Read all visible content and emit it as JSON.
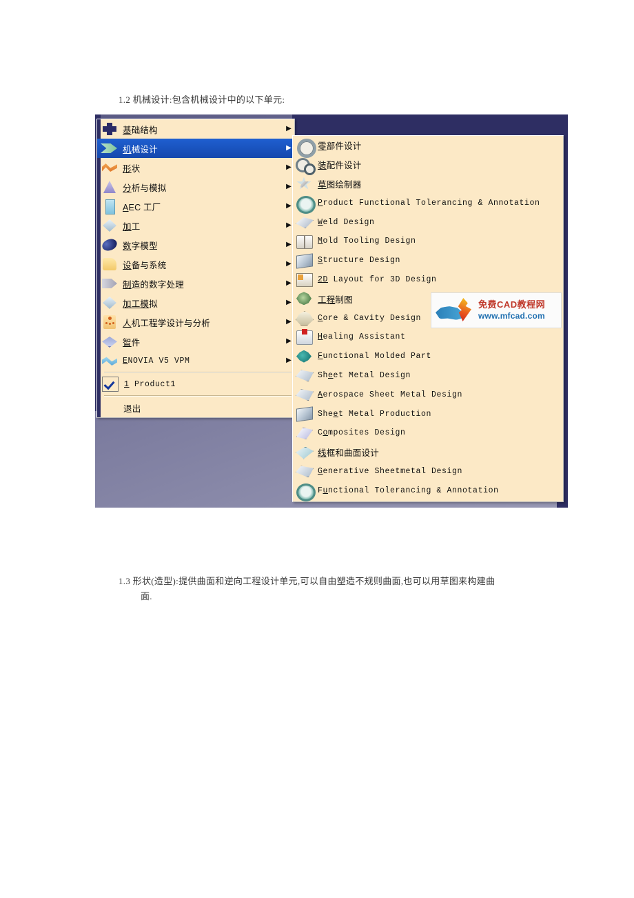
{
  "document": {
    "para_1_2": "1.2  机械设计:包含机械设计中的以下单元:",
    "para_1_3_line1": "1.3  形状(造型):提供曲面和逆向工程设计单元,可以自由塑造不规则曲面,也可以用草图来构建曲",
    "para_1_3_line2": "面."
  },
  "start_menu": {
    "items": [
      {
        "label": "基础结构",
        "icon": "cross-icon",
        "arrow": "▶",
        "selected": false
      },
      {
        "label": "机械设计",
        "icon": "green-arrow-icon",
        "arrow": "▶",
        "selected": true
      },
      {
        "label": "形状",
        "icon": "orange-wave-icon",
        "arrow": "▶",
        "selected": false
      },
      {
        "label": "分析与模拟",
        "icon": "purple-triangle-icon",
        "arrow": "▶",
        "selected": false
      },
      {
        "label": "AEC 工厂",
        "icon": "blue-tower-icon",
        "arrow": "▶",
        "selected": false
      },
      {
        "label": "加工",
        "icon": "diamond-icon",
        "arrow": "▶",
        "selected": false
      },
      {
        "label": "数字模型",
        "icon": "blue-ellipse-icon",
        "arrow": "▶",
        "selected": false
      },
      {
        "label": "设备与系统",
        "icon": "yellow-square-icon",
        "arrow": "▶",
        "selected": false
      },
      {
        "label": "制造的数字处理",
        "icon": "gray-arrow-icon",
        "arrow": "▶",
        "selected": false
      },
      {
        "label": "加工模拟",
        "icon": "diamond-icon",
        "arrow": "▶",
        "selected": false
      },
      {
        "label": "人机工程学设计与分析",
        "icon": "person-icon",
        "arrow": "▶",
        "selected": false
      },
      {
        "label": "智件",
        "icon": "plates-icon",
        "arrow": "▶",
        "selected": false
      },
      {
        "label": "ENOVIA V5 VPM",
        "icon": "ribbon-icon",
        "arrow": "▶",
        "selected": false
      }
    ],
    "recent_document": {
      "label": "1 Product1",
      "checked": true
    },
    "exit": "退出"
  },
  "sub_menu": {
    "items": [
      {
        "label": "零部件设计",
        "icon": "gear-icon",
        "script": "cjk"
      },
      {
        "label": "装配件设计",
        "icon": "double-gear-icon",
        "script": "cjk"
      },
      {
        "label": "草图绘制器",
        "icon": "sketch-star-icon",
        "script": "cjk"
      },
      {
        "label": "Product Functional Tolerancing & Annotation",
        "icon": "tolerancing-icon",
        "script": "latin"
      },
      {
        "label": "Weld Design",
        "icon": "weld-icon",
        "script": "latin"
      },
      {
        "label": "Mold Tooling Design",
        "icon": "mold-icon",
        "script": "latin"
      },
      {
        "label": "Structure Design",
        "icon": "structure-icon",
        "script": "latin"
      },
      {
        "label": "2D Layout for 3D Design",
        "icon": "layout-2d-icon",
        "script": "latin"
      },
      {
        "label": "工程制图",
        "icon": "drafting-icon",
        "script": "cjk"
      },
      {
        "label": "Core & Cavity Design",
        "icon": "core-cavity-icon",
        "script": "latin"
      },
      {
        "label": "Healing Assistant",
        "icon": "healing-icon",
        "script": "latin"
      },
      {
        "label": "Functional Molded Part",
        "icon": "molded-part-icon",
        "script": "latin"
      },
      {
        "label": "Sheet Metal Design",
        "icon": "sheet-metal-icon",
        "script": "latin"
      },
      {
        "label": "Aerospace Sheet Metal  Design",
        "icon": "aerospace-icon",
        "script": "latin"
      },
      {
        "label": "Sheet Metal Production",
        "icon": "sheet-prod-icon",
        "script": "latin"
      },
      {
        "label": "Composites Design",
        "icon": "composites-icon",
        "script": "latin"
      },
      {
        "label": "线框和曲面设计",
        "icon": "wireframe-icon",
        "script": "cjk"
      },
      {
        "label": "Generative Sheetmetal Design",
        "icon": "generative-icon",
        "script": "latin"
      },
      {
        "label": "Functional Tolerancing & Annotation",
        "icon": "tolerancing-icon",
        "script": "latin"
      }
    ]
  },
  "watermark": {
    "title": "免费CAD教程网",
    "url": "www.mfcad.com"
  },
  "colors": {
    "menu_bg": "#fce9c6",
    "menu_selected": "#1448ad",
    "navy_band": "#2e2e63",
    "desktop": "#7b7b9e",
    "watermark_red": "#c0392b",
    "watermark_blue": "#1f6fb0"
  }
}
